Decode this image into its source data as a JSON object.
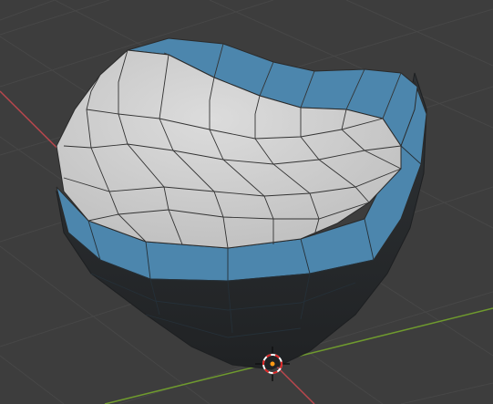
{
  "viewport": {
    "mode": "edit-mode-face-select",
    "background_color": "#3d3d3d",
    "grid_color": "#474747",
    "x_axis_color": "#b8474d",
    "y_axis_color": "#6f9a2e",
    "unselected_face_color": "#d2d2d2",
    "selected_face_color": "#4c86ad",
    "underside_color": "#2c3034",
    "wire_color": "#2a2a2a",
    "cursor_color": "#ff9a14",
    "icons": {
      "cursor": "3d-cursor-icon",
      "origin": "object-origin-icon"
    }
  }
}
